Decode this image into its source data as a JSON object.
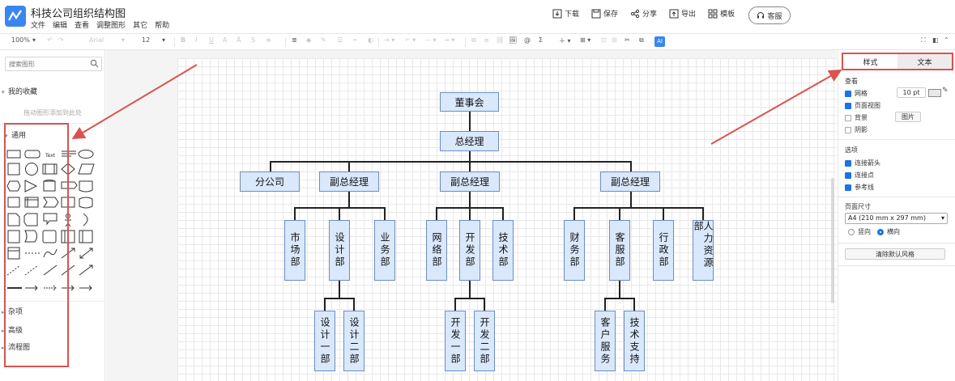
{
  "app": {
    "title": "科技公司组织结构图",
    "menu": [
      "文件",
      "编辑",
      "查看",
      "调整图形",
      "其它",
      "帮助"
    ]
  },
  "header_actions": [
    {
      "icon": "download-icon",
      "label": "下载"
    },
    {
      "icon": "save-icon",
      "label": "保存"
    },
    {
      "icon": "share-icon",
      "label": "分享"
    },
    {
      "icon": "export-icon",
      "label": "导出"
    },
    {
      "icon": "template-icon",
      "label": "模板"
    }
  ],
  "service_button": "客服",
  "toolbar": {
    "zoom": "100%",
    "font": "Arial",
    "font_size": "12",
    "ai": "AI"
  },
  "left_panel": {
    "search_placeholder": "搜索图形",
    "favorites": "我的收藏",
    "favorites_hint": "拖动图形添加到此处",
    "general": "通用",
    "misc": "杂项",
    "advanced": "高级",
    "flowchart": "流程图"
  },
  "org_chart": {
    "board": "董事会",
    "gm": "总经理",
    "branch": "分公司",
    "vp": "副总经理",
    "departments": {
      "market": "市场部",
      "design": "设计部",
      "business": "业务部",
      "network": "网络部",
      "development": "开发部",
      "tech": "技术部",
      "finance": "财务部",
      "customer_service": "客服部",
      "admin": "行政部",
      "hr": "人力资源部"
    },
    "sub_departments": {
      "design1": "设计一部",
      "design2": "设计二部",
      "dev1": "开发一部",
      "dev2": "开发二部",
      "cust_service": "客户服务",
      "tech_support": "技术支持"
    }
  },
  "right_panel": {
    "tab_style": "样式",
    "tab_text": "文本",
    "view_label": "查看",
    "grid": "网格",
    "grid_size": "10 pt",
    "page_view": "页面视图",
    "background": "背景",
    "image_button": "图片",
    "shadow": "阴影",
    "options_label": "选项",
    "connect_arrows": "连接箭头",
    "connect_points": "连接点",
    "guides": "参考线",
    "page_size_label": "页面尺寸",
    "page_size_value": "A4 (210 mm x 297 mm)",
    "portrait": "竖向",
    "landscape": "横向",
    "reset_style": "清除默认风格"
  },
  "colors": {
    "node_fill": "#dae8fc",
    "node_stroke": "#6c8ebf",
    "accent": "#3a86f0",
    "highlight": "#d9534f"
  }
}
